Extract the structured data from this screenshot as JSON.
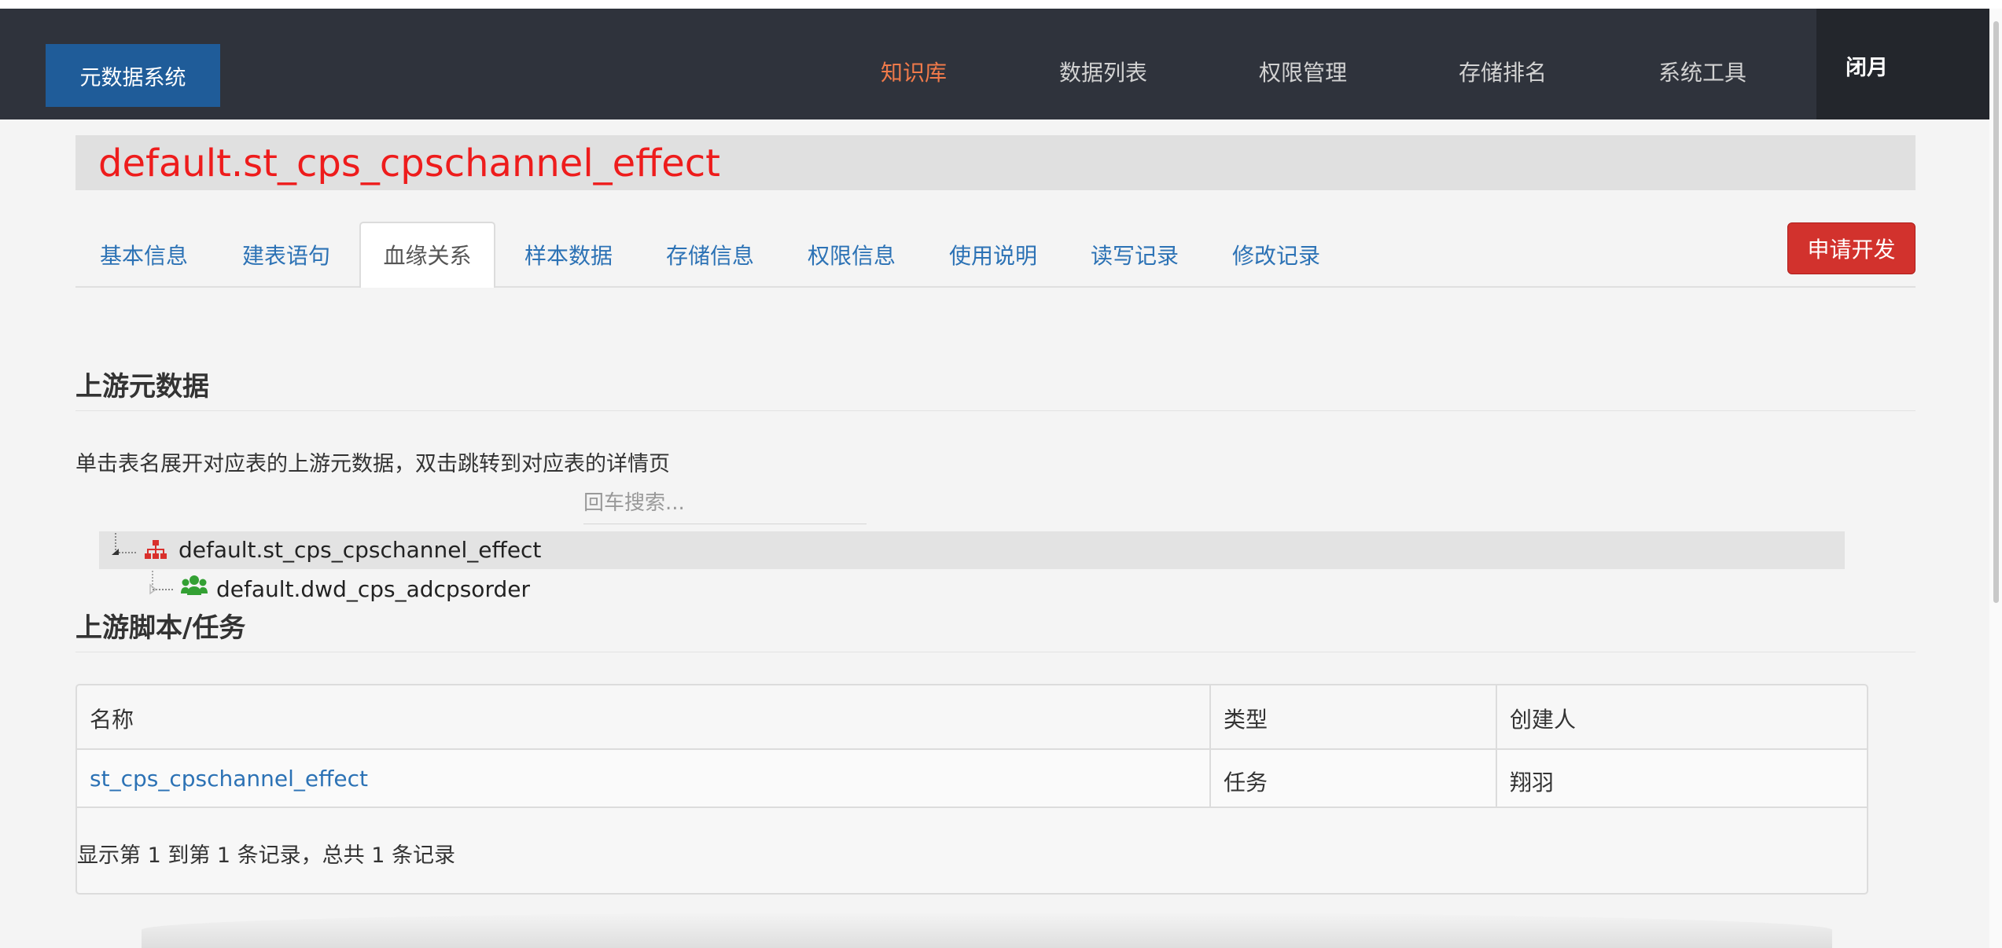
{
  "navbar": {
    "brand": "元数据系统",
    "items": [
      {
        "label": "知识库",
        "active": true
      },
      {
        "label": "数据列表",
        "active": false
      },
      {
        "label": "权限管理",
        "active": false
      },
      {
        "label": "存储排名",
        "active": false
      },
      {
        "label": "系统工具",
        "active": false
      }
    ],
    "user": "闭月"
  },
  "page": {
    "title": "default.st_cps_cpschannel_effect"
  },
  "tabs": [
    {
      "label": "基本信息",
      "active": false
    },
    {
      "label": "建表语句",
      "active": false
    },
    {
      "label": "血缘关系",
      "active": true
    },
    {
      "label": "样本数据",
      "active": false
    },
    {
      "label": "存储信息",
      "active": false
    },
    {
      "label": "权限信息",
      "active": false
    },
    {
      "label": "使用说明",
      "active": false
    },
    {
      "label": "读写记录",
      "active": false
    },
    {
      "label": "修改记录",
      "active": false
    }
  ],
  "apply_button": "申请开发",
  "upstream_meta": {
    "title": "上游元数据",
    "hint": "单击表名展开对应表的上游元数据，双击跳转到对应表的详情页",
    "search_placeholder": "回车搜索...",
    "tree": {
      "root": {
        "name": "default.st_cps_cpschannel_effect",
        "icon": "sitemap-icon",
        "color": "#d9302c"
      },
      "children": [
        {
          "name": "default.dwd_cps_adcpsorder",
          "icon": "users-icon",
          "color": "#33a033"
        }
      ]
    }
  },
  "upstream_tasks": {
    "title": "上游脚本/任务",
    "columns": [
      "名称",
      "类型",
      "创建人"
    ],
    "rows": [
      {
        "name": "st_cps_cpschannel_effect",
        "type": "任务",
        "creator": "翔羽"
      }
    ],
    "footer": "显示第 1 到第 1 条记录，总共 1 条记录"
  },
  "colors": {
    "navbar_bg": "#2f333c",
    "brand_bg": "#1f5c99",
    "active_nav": "#f07a4a",
    "title_red": "#ee1c1c",
    "link_blue": "#2c72b5",
    "danger_button": "#d2322d"
  }
}
